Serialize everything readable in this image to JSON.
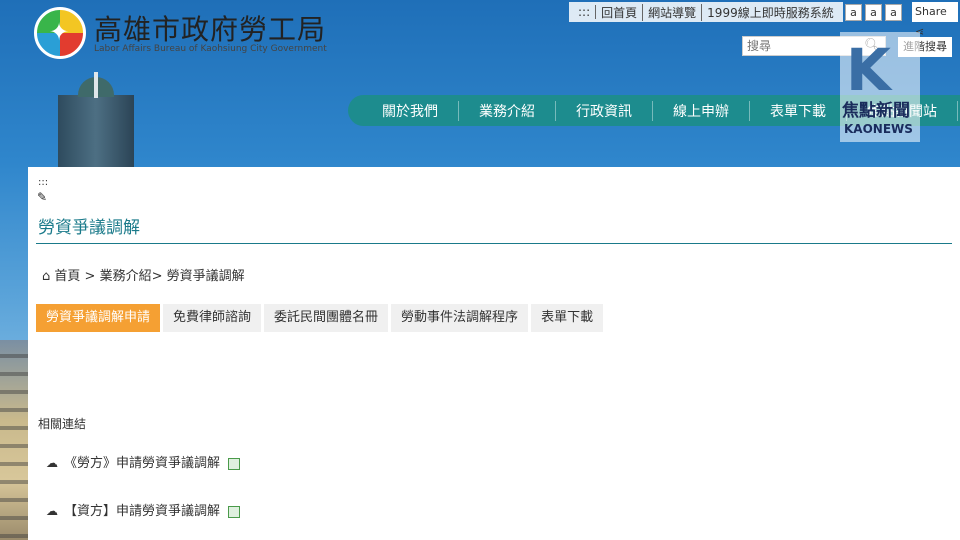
{
  "header": {
    "title": "高雄市政府勞工局",
    "subtitle": "Labor Affairs Bureau of Kaohsiung City Government",
    "top_links": [
      ":::",
      "回首頁",
      "網站導覽",
      "1999線上即時服務系統"
    ],
    "font_sizes": [
      "a",
      "a",
      "a"
    ],
    "share_label": "Share",
    "search_placeholder": "搜尋",
    "advanced_search": "進階搜尋"
  },
  "nav": {
    "items": [
      "關於我們",
      "業務介紹",
      "行政資訊",
      "線上申辦",
      "表單下載",
      "焦點新聞站"
    ]
  },
  "watermark": {
    "letter": "K",
    "line1": "焦點新聞",
    "line2": "KAONEWS"
  },
  "content": {
    "anchor": ":::",
    "page_title": "勞資爭議調解",
    "breadcrumb": "首頁 > 業務介紹> 勞資爭議調解",
    "tabs": [
      "勞資爭議調解申請",
      "免費律師諮詢",
      "委託民間團體名冊",
      "勞動事件法調解程序",
      "表單下載"
    ],
    "related_heading": "相關連結",
    "links": [
      "《勞方》申請勞資爭議調解",
      "【資方】申請勞資爭議調解"
    ]
  },
  "colors": {
    "nav_bg": "#1d8c8e",
    "active_tab": "#f5a033",
    "title_color": "#1a7a8a"
  }
}
